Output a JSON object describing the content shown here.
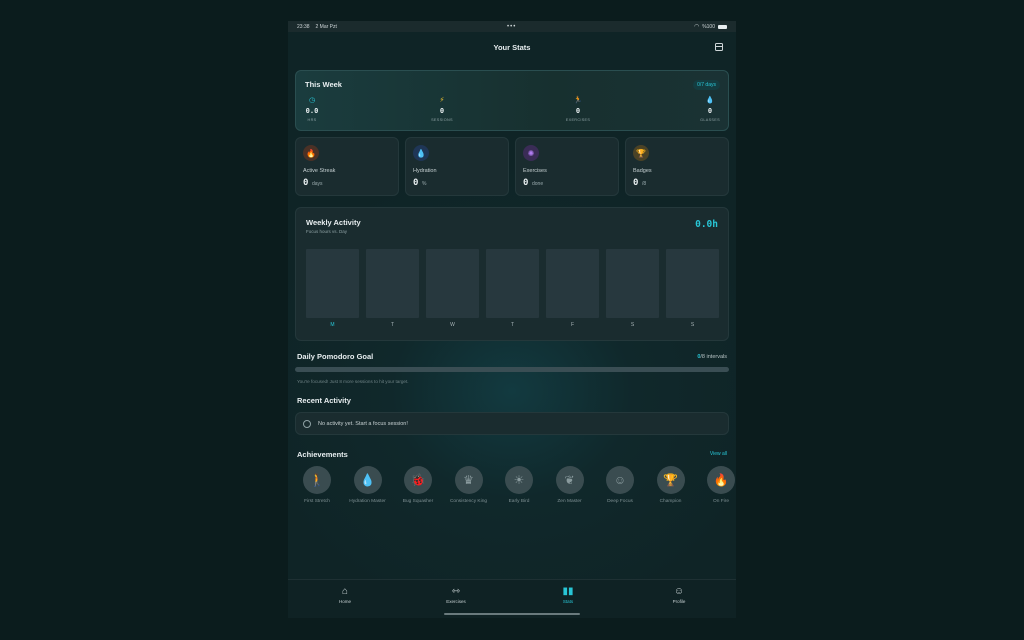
{
  "status": {
    "time": "23:38",
    "date": "2 Mar Pzt",
    "battery": "%100"
  },
  "header": {
    "title": "Your Stats"
  },
  "this_week": {
    "title": "This Week",
    "days_pill": "0/7 days",
    "stats": [
      {
        "value": "0.0",
        "label": "HRS",
        "icon": "timer-icon",
        "color": "#28c6d6"
      },
      {
        "value": "0",
        "label": "SESSIONS",
        "icon": "bolt-icon",
        "color": "#f2c230"
      },
      {
        "value": "0",
        "label": "EXERCISES",
        "icon": "walk-icon",
        "color": "#38c978"
      },
      {
        "value": "0",
        "label": "GLASSES",
        "icon": "drop-icon",
        "color": "#5ab2f0"
      }
    ]
  },
  "cards": [
    {
      "label": "Active Streak",
      "value": "0",
      "unit": "days",
      "icon": "flame-icon",
      "color": "#e0702c",
      "bg": "#4a3126"
    },
    {
      "label": "Hydration",
      "value": "0",
      "unit": "%",
      "icon": "drop-icon",
      "color": "#4a9cf0",
      "bg": "#1f3656"
    },
    {
      "label": "Exercises",
      "value": "0",
      "unit": "done",
      "icon": "person-icon",
      "color": "#b07cf0",
      "bg": "#3a2c56"
    },
    {
      "label": "Badges",
      "value": "0",
      "unit": "/8",
      "icon": "trophy-icon",
      "color": "#e2b23a",
      "bg": "#4a4226"
    }
  ],
  "weekly_activity": {
    "title": "Weekly Activity",
    "subtitle": "Focus hours vs. Day",
    "total": "0.0h",
    "days": [
      "M",
      "T",
      "W",
      "T",
      "F",
      "S",
      "S"
    ],
    "active_index": 0
  },
  "pomodoro": {
    "title": "Daily Pomodoro Goal",
    "count": "0",
    "count_suffix": "/8 intervals",
    "progress": 0,
    "message": "You're focused! Just 8 more sessions to hit your target."
  },
  "recent": {
    "title": "Recent Activity",
    "empty": "No activity yet. Start a focus session!"
  },
  "achievements": {
    "title": "Achievements",
    "view_all": "View all",
    "items": [
      {
        "name": "First Stretch",
        "icon": "walk-icon",
        "glyph": "🚶"
      },
      {
        "name": "Hydration Master",
        "icon": "drop-icon",
        "glyph": "💧"
      },
      {
        "name": "Bug Squasher",
        "icon": "bug-icon",
        "glyph": "🐞"
      },
      {
        "name": "Consistency King",
        "icon": "crown-icon",
        "glyph": "♛"
      },
      {
        "name": "Early Bird",
        "icon": "sunrise-icon",
        "glyph": "☀"
      },
      {
        "name": "Zen Master",
        "icon": "leaf-icon",
        "glyph": "❦"
      },
      {
        "name": "Deep Focus",
        "icon": "head-icon",
        "glyph": "☺"
      },
      {
        "name": "Champion",
        "icon": "trophy-icon",
        "glyph": "🏆"
      },
      {
        "name": "On Fire",
        "icon": "flame-icon",
        "glyph": "🔥"
      }
    ]
  },
  "tabs": [
    {
      "label": "Home",
      "icon": "home-icon",
      "glyph": "⌂"
    },
    {
      "label": "Exercises",
      "icon": "dumbbell-icon",
      "glyph": "⇿"
    },
    {
      "label": "Stats",
      "icon": "bar-chart-icon",
      "glyph": "▮▮"
    },
    {
      "label": "Profile",
      "icon": "user-icon",
      "glyph": "☺"
    }
  ],
  "active_tab": 2
}
